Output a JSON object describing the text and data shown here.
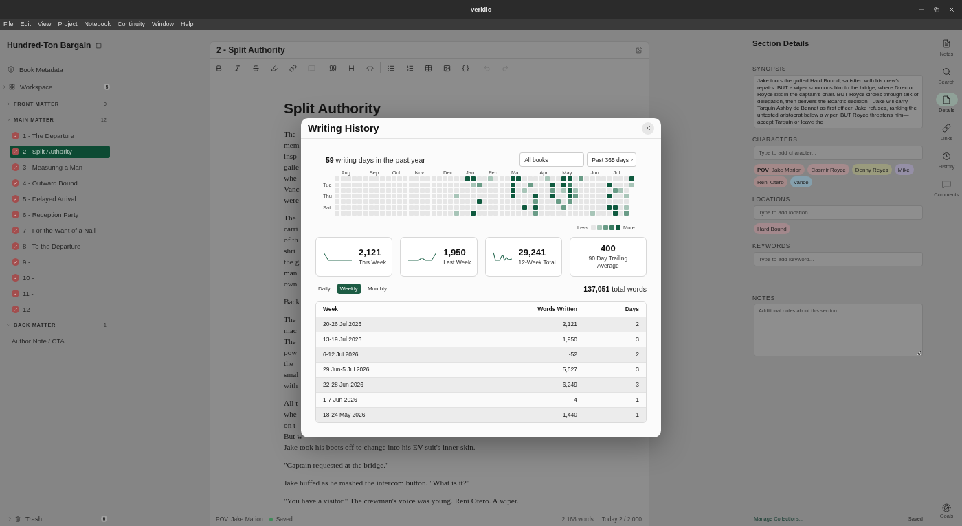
{
  "window": {
    "title": "Verkilo"
  },
  "menu": [
    "File",
    "Edit",
    "View",
    "Project",
    "Notebook",
    "Continuity",
    "Window",
    "Help"
  ],
  "sidebar": {
    "title": "Hundred-Ton Bargain",
    "metadata": {
      "label": "Book Metadata"
    },
    "workspace": {
      "label": "Workspace",
      "count": "5",
      "expanded": false
    },
    "sections": [
      {
        "label": "FRONT MATTER",
        "count": "0",
        "expanded": false
      },
      {
        "label": "MAIN MATTER",
        "count": "12",
        "expanded": true,
        "items": [
          {
            "kind": "chapter",
            "label": "1 - The Departure",
            "selected": false
          },
          {
            "kind": "chapter",
            "label": "2 - Split Authority",
            "selected": true
          },
          {
            "kind": "chapter",
            "label": "3 - Measuring a Man",
            "selected": false
          },
          {
            "kind": "chapter",
            "label": "4 - Outward Bound",
            "selected": false
          },
          {
            "kind": "chapter",
            "label": "5 - Delayed Arrival",
            "selected": false
          },
          {
            "kind": "chapter",
            "label": "6 - Reception Party",
            "selected": false
          },
          {
            "kind": "chapter",
            "label": "7 - For the Want of a Nail",
            "selected": false
          },
          {
            "kind": "chapter",
            "label": "8 - To the Departure",
            "selected": false
          },
          {
            "kind": "chapter",
            "label": "9 -",
            "selected": false
          },
          {
            "kind": "chapter",
            "label": "10 -",
            "selected": false
          },
          {
            "kind": "chapter",
            "label": "11 -",
            "selected": false
          },
          {
            "kind": "chapter",
            "label": "12 -",
            "selected": false
          }
        ]
      },
      {
        "label": "BACK MATTER",
        "count": "1",
        "expanded": true,
        "items": [
          {
            "kind": "page",
            "label": "Author Note / CTA",
            "selected": false
          }
        ]
      }
    ],
    "trash": {
      "label": "Trash",
      "count": "0",
      "expanded": false
    }
  },
  "editor": {
    "title": "2 - Split Authority",
    "toolbar": [
      [
        {
          "kind": "bold",
          "disabled": false
        },
        {
          "kind": "italic",
          "disabled": false
        },
        {
          "kind": "strikethrough",
          "disabled": false
        },
        {
          "kind": "highlight",
          "disabled": false
        },
        {
          "kind": "link",
          "disabled": false
        },
        {
          "kind": "comment",
          "disabled": true
        }
      ],
      [
        {
          "kind": "quote",
          "disabled": false
        },
        {
          "kind": "heading",
          "disabled": false
        },
        {
          "kind": "code",
          "disabled": false
        }
      ],
      [
        {
          "kind": "bullet_list",
          "disabled": false
        },
        {
          "kind": "numbered_list",
          "disabled": false
        },
        {
          "kind": "table",
          "disabled": false
        },
        {
          "kind": "image",
          "disabled": false
        },
        {
          "kind": "variable",
          "disabled": false
        }
      ],
      [
        {
          "kind": "undo",
          "disabled": true
        },
        {
          "kind": "redo",
          "disabled": true
        }
      ]
    ],
    "heading": "Split Authority",
    "paragraphs": [
      {
        "lines": [
          "The",
          "mem",
          "insp",
          "galle",
          "whe",
          "Vanc",
          "were"
        ]
      },
      {
        "lines": [
          "The",
          "carri",
          "of th",
          "shri",
          "the g",
          "man",
          "own"
        ]
      },
      {
        "lines": [
          "Back"
        ]
      },
      {
        "lines": [
          "The",
          "mac",
          "The",
          "pow",
          "the",
          "smal",
          "with"
        ]
      },
      {
        "lines": [
          "All t",
          "whe",
          "on t",
          "But w",
          "Jake took his boots off to change into his EV suit's inner skin."
        ]
      },
      {
        "lines": [
          "\"Captain requested at the bridge.\""
        ]
      },
      {
        "lines": [
          "Jake huffed as he mashed the intercom button. \"What is it?\""
        ]
      },
      {
        "lines": [
          "\"You have a visitor.\" The crewman's voice was young. Reni Otero. A wiper."
        ]
      }
    ],
    "status_bar": {
      "pov": "POV: Jake Marion",
      "save_state": "Saved",
      "word_count": "2,168 words",
      "daily_goal": "Today 2 / 2,000"
    }
  },
  "details": {
    "title": "Section Details",
    "synopsis": {
      "label": "SYNOPSIS",
      "value": "Jake tours the gutted Hard Bound, satisfied with his crew's repairs. BUT a wiper summons him to the bridge, where Director Royce sits in the captain's chair. BUT Royce circles through talk of delegation, then delivers the Board's decision—Jake will carry Tarquin Ashby de Bennet as first officer. Jake refuses, ranking the untested aristocrat below a wiper. BUT Royce threatens him—accept Tarquin or leave the"
    },
    "characters": {
      "label": "CHARACTERS",
      "placeholder": "Type to add character...",
      "tags": [
        {
          "label": "**POV** Jake Marion",
          "color": "#a38888"
        },
        {
          "label": "Casmir Royce",
          "color": "#a58a8c"
        },
        {
          "label": "Denny Reyes",
          "color": "#9a9b7d"
        },
        {
          "label": "Mikel",
          "color": "#958fa6"
        },
        {
          "label": "Reni Otero",
          "color": "#a38888"
        },
        {
          "label": "Vance",
          "color": "#85a0ad"
        }
      ]
    },
    "locations": {
      "label": "LOCATIONS",
      "placeholder": "Type to add location...",
      "tags": [
        {
          "label": "Hard Bound",
          "color": "#a3888c"
        }
      ]
    },
    "keywords": {
      "label": "KEYWORDS",
      "placeholder": "Type to add keyword..."
    },
    "notes": {
      "label": "NOTES",
      "placeholder": "Additional notes about this section..."
    },
    "footer_link": "Manage Collections...",
    "save_state": "Saved"
  },
  "rail": {
    "items": [
      {
        "kind": "notes",
        "label": "Notes",
        "selected": false
      },
      {
        "kind": "search",
        "label": "Search",
        "selected": false
      },
      {
        "kind": "details",
        "label": "Details",
        "selected": true
      },
      {
        "kind": "links",
        "label": "Links",
        "selected": false
      },
      {
        "kind": "history",
        "label": "History",
        "selected": false
      },
      {
        "kind": "comments",
        "label": "Comments",
        "selected": false
      }
    ],
    "goals": {
      "label": "Goals"
    }
  },
  "writing_history": {
    "title": "Writing History",
    "summary": "**59** writing days in the past year",
    "filters": [
      {
        "kind": "input",
        "value": "All books"
      },
      {
        "kind": "dropdown",
        "value": "Past 365 days"
      }
    ],
    "heatmap": {
      "day_labels": [
        "Tue",
        "Thu",
        "Sat"
      ],
      "weeks": [
        {
          "days": [
            {
              "color": "#e6e6e6"
            },
            {
              "color": "#e6e6e6"
            },
            {
              "color": "#e6e6e6"
            },
            {
              "color": "#e6e6e6"
            },
            {
              "color": "#e6e6e6"
            },
            {
              "color": "#e6e6e6"
            },
            {
              "color": "#e6e6e6"
            }
          ]
        },
        {
          "month": "Aug",
          "days": [
            {
              "color": "#e6e6e6"
            },
            {
              "color": "#e6e6e6"
            },
            {
              "color": "#e6e6e6"
            },
            {
              "color": "#e6e6e6"
            },
            {
              "color": "#e6e6e6"
            },
            {
              "color": "#e6e6e6"
            },
            {
              "color": "#e6e6e6"
            }
          ]
        },
        {
          "days": [
            {
              "color": "#e6e6e6"
            },
            {
              "color": "#e6e6e6"
            },
            {
              "color": "#e6e6e6"
            },
            {
              "color": "#e6e6e6"
            },
            {
              "color": "#e6e6e6"
            },
            {
              "color": "#e6e6e6"
            },
            {
              "color": "#e6e6e6"
            }
          ]
        },
        {
          "days": [
            {
              "color": "#e6e6e6"
            },
            {
              "color": "#e6e6e6"
            },
            {
              "color": "#e6e6e6"
            },
            {
              "color": "#e6e6e6"
            },
            {
              "color": "#e6e6e6"
            },
            {
              "color": "#e6e6e6"
            },
            {
              "color": "#e6e6e6"
            }
          ]
        },
        {
          "days": [
            {
              "color": "#e6e6e6"
            },
            {
              "color": "#e6e6e6"
            },
            {
              "color": "#e6e6e6"
            },
            {
              "color": "#e6e6e6"
            },
            {
              "color": "#e6e6e6"
            },
            {
              "color": "#e6e6e6"
            },
            {
              "color": "#e6e6e6"
            }
          ]
        },
        {
          "days": [
            {
              "color": "#e6e6e6"
            },
            {
              "color": "#e6e6e6"
            },
            {
              "color": "#e6e6e6"
            },
            {
              "color": "#e6e6e6"
            },
            {
              "color": "#e6e6e6"
            },
            {
              "color": "#e6e6e6"
            },
            {
              "color": "#e6e6e6"
            }
          ]
        },
        {
          "month": "Sep",
          "days": [
            {
              "color": "#e6e6e6"
            },
            {
              "color": "#e6e6e6"
            },
            {
              "color": "#e6e6e6"
            },
            {
              "color": "#e6e6e6"
            },
            {
              "color": "#e6e6e6"
            },
            {
              "color": "#e6e6e6"
            },
            {
              "color": "#e6e6e6"
            }
          ]
        },
        {
          "days": [
            {
              "color": "#e6e6e6"
            },
            {
              "color": "#e6e6e6"
            },
            {
              "color": "#e6e6e6"
            },
            {
              "color": "#e6e6e6"
            },
            {
              "color": "#e6e6e6"
            },
            {
              "color": "#e6e6e6"
            },
            {
              "color": "#e6e6e6"
            }
          ]
        },
        {
          "days": [
            {
              "color": "#e6e6e6"
            },
            {
              "color": "#e6e6e6"
            },
            {
              "color": "#e6e6e6"
            },
            {
              "color": "#e6e6e6"
            },
            {
              "color": "#e6e6e6"
            },
            {
              "color": "#e6e6e6"
            },
            {
              "color": "#e6e6e6"
            }
          ]
        },
        {
          "days": [
            {
              "color": "#e6e6e6"
            },
            {
              "color": "#e6e6e6"
            },
            {
              "color": "#e6e6e6"
            },
            {
              "color": "#e6e6e6"
            },
            {
              "color": "#e6e6e6"
            },
            {
              "color": "#e6e6e6"
            },
            {
              "color": "#e6e6e6"
            }
          ]
        },
        {
          "month": "Oct",
          "days": [
            {
              "color": "#e6e6e6"
            },
            {
              "color": "#e6e6e6"
            },
            {
              "color": "#e6e6e6"
            },
            {
              "color": "#e6e6e6"
            },
            {
              "color": "#e6e6e6"
            },
            {
              "color": "#e6e6e6"
            },
            {
              "color": "#e6e6e6"
            }
          ]
        },
        {
          "days": [
            {
              "color": "#e6e6e6"
            },
            {
              "color": "#e6e6e6"
            },
            {
              "color": "#e6e6e6"
            },
            {
              "color": "#e6e6e6"
            },
            {
              "color": "#e6e6e6"
            },
            {
              "color": "#e6e6e6"
            },
            {
              "color": "#e6e6e6"
            }
          ]
        },
        {
          "days": [
            {
              "color": "#e6e6e6"
            },
            {
              "color": "#e6e6e6"
            },
            {
              "color": "#e6e6e6"
            },
            {
              "color": "#e6e6e6"
            },
            {
              "color": "#e6e6e6"
            },
            {
              "color": "#e6e6e6"
            },
            {
              "color": "#e6e6e6"
            }
          ]
        },
        {
          "days": [
            {
              "color": "#e6e6e6"
            },
            {
              "color": "#e6e6e6"
            },
            {
              "color": "#e6e6e6"
            },
            {
              "color": "#e6e6e6"
            },
            {
              "color": "#e6e6e6"
            },
            {
              "color": "#e6e6e6"
            },
            {
              "color": "#e6e6e6"
            }
          ]
        },
        {
          "month": "Nov",
          "days": [
            {
              "color": "#e6e6e6"
            },
            {
              "color": "#e6e6e6"
            },
            {
              "color": "#e6e6e6"
            },
            {
              "color": "#e6e6e6"
            },
            {
              "color": "#e6e6e6"
            },
            {
              "color": "#e6e6e6"
            },
            {
              "color": "#e6e6e6"
            }
          ]
        },
        {
          "days": [
            {
              "color": "#e6e6e6"
            },
            {
              "color": "#e6e6e6"
            },
            {
              "color": "#e6e6e6"
            },
            {
              "color": "#e6e6e6"
            },
            {
              "color": "#e6e6e6"
            },
            {
              "color": "#e6e6e6"
            },
            {
              "color": "#e6e6e6"
            }
          ]
        },
        {
          "days": [
            {
              "color": "#e6e6e6"
            },
            {
              "color": "#e6e6e6"
            },
            {
              "color": "#e6e6e6"
            },
            {
              "color": "#e6e6e6"
            },
            {
              "color": "#e6e6e6"
            },
            {
              "color": "#e6e6e6"
            },
            {
              "color": "#e6e6e6"
            }
          ]
        },
        {
          "days": [
            {
              "color": "#e6e6e6"
            },
            {
              "color": "#e6e6e6"
            },
            {
              "color": "#e6e6e6"
            },
            {
              "color": "#e6e6e6"
            },
            {
              "color": "#e6e6e6"
            },
            {
              "color": "#e6e6e6"
            },
            {
              "color": "#e6e6e6"
            }
          ]
        },
        {
          "days": [
            {
              "color": "#e6e6e6"
            },
            {
              "color": "#e6e6e6"
            },
            {
              "color": "#e6e6e6"
            },
            {
              "color": "#e6e6e6"
            },
            {
              "color": "#e6e6e6"
            },
            {
              "color": "#e6e6e6"
            },
            {
              "color": "#e6e6e6"
            }
          ]
        },
        {
          "month": "Dec",
          "days": [
            {
              "color": "#e6e6e6"
            },
            {
              "color": "#e6e6e6"
            },
            {
              "color": "#e6e6e6"
            },
            {
              "color": "#e6e6e6"
            },
            {
              "color": "#e6e6e6"
            },
            {
              "color": "#e6e6e6"
            },
            {
              "color": "#e6e6e6"
            }
          ]
        },
        {
          "days": [
            {
              "color": "#e6e6e6"
            },
            {
              "color": "#e6e6e6"
            },
            {
              "color": "#e6e6e6"
            },
            {
              "color": "#e6e6e6"
            },
            {
              "color": "#e6e6e6"
            },
            {
              "color": "#e6e6e6"
            },
            {
              "color": "#e6e6e6"
            }
          ]
        },
        {
          "days": [
            {
              "color": "#e6e6e6"
            },
            {
              "color": "#e6e6e6"
            },
            {
              "color": "#e6e6e6"
            },
            {
              "color": "#a8c5b8"
            },
            {
              "color": "#e6e6e6"
            },
            {
              "color": "#e6e6e6"
            },
            {
              "color": "#a8c5b8"
            }
          ]
        },
        {
          "days": [
            {
              "color": "#e6e6e6"
            },
            {
              "color": "#e6e6e6"
            },
            {
              "color": "#e6e6e6"
            },
            {
              "color": "#e6e6e6"
            },
            {
              "color": "#e6e6e6"
            },
            {
              "color": "#e6e6e6"
            },
            {
              "color": "#e6e6e6"
            }
          ]
        },
        {
          "month": "Jan",
          "days": [
            {
              "color": "#0f5a3f"
            },
            {
              "color": "#e6e6e6"
            },
            {
              "color": "#e6e6e6"
            },
            {
              "color": "#e6e6e6"
            },
            {
              "color": "#e6e6e6"
            },
            {
              "color": "#e6e6e6"
            },
            {
              "color": "#e6e6e6"
            }
          ]
        },
        {
          "days": [
            {
              "color": "#0f5a3f"
            },
            {
              "color": "#a8c5b8"
            },
            {
              "color": "#e6e6e6"
            },
            {
              "color": "#e6e6e6"
            },
            {
              "color": "#e6e6e6"
            },
            {
              "color": "#e6e6e6"
            },
            {
              "color": "#0f5a3f"
            }
          ]
        },
        {
          "days": [
            {
              "color": "#e6e6e6"
            },
            {
              "color": "#6a9c87"
            },
            {
              "color": "#e6e6e6"
            },
            {
              "color": "#e6e6e6"
            },
            {
              "color": "#0f5a3f"
            },
            {
              "color": "#e6e6e6"
            },
            {
              "color": "#e6e6e6"
            }
          ]
        },
        {
          "days": [
            {
              "color": "#e6e6e6"
            },
            {
              "color": "#e6e6e6"
            },
            {
              "color": "#e6e6e6"
            },
            {
              "color": "#e6e6e6"
            },
            {
              "color": "#e6e6e6"
            },
            {
              "color": "#e6e6e6"
            },
            {
              "color": "#e6e6e6"
            }
          ]
        },
        {
          "month": "Feb",
          "days": [
            {
              "color": "#a8c5b8"
            },
            {
              "color": "#e6e6e6"
            },
            {
              "color": "#e6e6e6"
            },
            {
              "color": "#e6e6e6"
            },
            {
              "color": "#e6e6e6"
            },
            {
              "color": "#e6e6e6"
            },
            {
              "color": "#e6e6e6"
            }
          ]
        },
        {
          "days": [
            {
              "color": "#e6e6e6"
            },
            {
              "color": "#e6e6e6"
            },
            {
              "color": "#e6e6e6"
            },
            {
              "color": "#e6e6e6"
            },
            {
              "color": "#e6e6e6"
            },
            {
              "color": "#e6e6e6"
            },
            {
              "color": "#e6e6e6"
            }
          ]
        },
        {
          "days": [
            {
              "color": "#e6e6e6"
            },
            {
              "color": "#e6e6e6"
            },
            {
              "color": "#e6e6e6"
            },
            {
              "color": "#e6e6e6"
            },
            {
              "color": "#e6e6e6"
            },
            {
              "color": "#e6e6e6"
            },
            {
              "color": "#e6e6e6"
            }
          ]
        },
        {
          "days": [
            {
              "color": "#e6e6e6"
            },
            {
              "color": "#e6e6e6"
            },
            {
              "color": "#e6e6e6"
            },
            {
              "color": "#e6e6e6"
            },
            {
              "color": "#e6e6e6"
            },
            {
              "color": "#e6e6e6"
            },
            {
              "color": "#e6e6e6"
            }
          ]
        },
        {
          "month": "Mar",
          "days": [
            {
              "color": "#0f5a3f"
            },
            {
              "color": "#0f5a3f"
            },
            {
              "color": "#0f5a3f"
            },
            {
              "color": "#0f5a3f"
            },
            {
              "color": "#e6e6e6"
            },
            {
              "color": "#e6e6e6"
            },
            {
              "color": "#e6e6e6"
            }
          ]
        },
        {
          "days": [
            {
              "color": "#0f5a3f"
            },
            {
              "color": "#e6e6e6"
            },
            {
              "color": "#e6e6e6"
            },
            {
              "color": "#e6e6e6"
            },
            {
              "color": "#e6e6e6"
            },
            {
              "color": "#e6e6e6"
            },
            {
              "color": "#e6e6e6"
            }
          ]
        },
        {
          "days": [
            {
              "color": "#e6e6e6"
            },
            {
              "color": "#e6e6e6"
            },
            {
              "color": "#a8c5b8"
            },
            {
              "color": "#e6e6e6"
            },
            {
              "color": "#e6e6e6"
            },
            {
              "color": "#0f5a3f"
            },
            {
              "color": "#e6e6e6"
            }
          ]
        },
        {
          "days": [
            {
              "color": "#e6e6e6"
            },
            {
              "color": "#6a9c87"
            },
            {
              "color": "#e6e6e6"
            },
            {
              "color": "#e6e6e6"
            },
            {
              "color": "#e6e6e6"
            },
            {
              "color": "#e6e6e6"
            },
            {
              "color": "#e6e6e6"
            }
          ]
        },
        {
          "days": [
            {
              "color": "#e6e6e6"
            },
            {
              "color": "#e6e6e6"
            },
            {
              "color": "#e6e6e6"
            },
            {
              "color": "#0f5a3f"
            },
            {
              "color": "#6a9c87"
            },
            {
              "color": "#0f5a3f"
            },
            {
              "color": "#6a9c87"
            }
          ]
        },
        {
          "month": "Apr",
          "days": [
            {
              "color": "#e6e6e6"
            },
            {
              "color": "#e6e6e6"
            },
            {
              "color": "#e6e6e6"
            },
            {
              "color": "#e6e6e6"
            },
            {
              "color": "#e6e6e6"
            },
            {
              "color": "#e6e6e6"
            },
            {
              "color": "#e6e6e6"
            }
          ]
        },
        {
          "days": [
            {
              "color": "#a8c5b8"
            },
            {
              "color": "#e6e6e6"
            },
            {
              "color": "#e6e6e6"
            },
            {
              "color": "#e6e6e6"
            },
            {
              "color": "#e6e6e6"
            },
            {
              "color": "#e6e6e6"
            },
            {
              "color": "#e6e6e6"
            }
          ]
        },
        {
          "days": [
            {
              "color": "#e6e6e6"
            },
            {
              "color": "#0f5a3f"
            },
            {
              "color": "#6a9c87"
            },
            {
              "color": "#0f5a3f"
            },
            {
              "color": "#e6e6e6"
            },
            {
              "color": "#e6e6e6"
            },
            {
              "color": "#e6e6e6"
            }
          ]
        },
        {
          "days": [
            {
              "color": "#e6e6e6"
            },
            {
              "color": "#e6e6e6"
            },
            {
              "color": "#e6e6e6"
            },
            {
              "color": "#e6e6e6"
            },
            {
              "color": "#6a9c87"
            },
            {
              "color": "#e6e6e6"
            },
            {
              "color": "#e6e6e6"
            }
          ]
        },
        {
          "month": "May",
          "days": [
            {
              "color": "#0f5a3f"
            },
            {
              "color": "#0f5a3f"
            },
            {
              "color": "#a8c5b8"
            },
            {
              "color": "#e6e6e6"
            },
            {
              "color": "#e6e6e6"
            },
            {
              "color": "#6a9c87"
            },
            {
              "color": "#e6e6e6"
            }
          ]
        },
        {
          "days": [
            {
              "color": "#0f5a3f"
            },
            {
              "color": "#3c7d63"
            },
            {
              "color": "#0f5a3f"
            },
            {
              "color": "#0f5a3f"
            },
            {
              "color": "#6a9c87"
            },
            {
              "color": "#e6e6e6"
            },
            {
              "color": "#e6e6e6"
            }
          ]
        },
        {
          "days": [
            {
              "color": "#e6e6e6"
            },
            {
              "color": "#e6e6e6"
            },
            {
              "color": "#a8c5b8"
            },
            {
              "color": "#6a9c87"
            },
            {
              "color": "#e6e6e6"
            },
            {
              "color": "#e6e6e6"
            },
            {
              "color": "#e6e6e6"
            }
          ]
        },
        {
          "days": [
            {
              "color": "#6a9c87"
            },
            {
              "color": "#e6e6e6"
            },
            {
              "color": "#e6e6e6"
            },
            {
              "color": "#e6e6e6"
            },
            {
              "color": "#e6e6e6"
            },
            {
              "color": "#e6e6e6"
            },
            {
              "color": "#e6e6e6"
            }
          ]
        },
        {
          "days": [
            {
              "color": "#e6e6e6"
            },
            {
              "color": "#e6e6e6"
            },
            {
              "color": "#e6e6e6"
            },
            {
              "color": "#e6e6e6"
            },
            {
              "color": "#e6e6e6"
            },
            {
              "color": "#e6e6e6"
            },
            {
              "color": "#e6e6e6"
            }
          ]
        },
        {
          "month": "Jun",
          "days": [
            {
              "color": "#e6e6e6"
            },
            {
              "color": "#e6e6e6"
            },
            {
              "color": "#e6e6e6"
            },
            {
              "color": "#e6e6e6"
            },
            {
              "color": "#e6e6e6"
            },
            {
              "color": "#e6e6e6"
            },
            {
              "color": "#a8c5b8"
            }
          ]
        },
        {
          "days": [
            {
              "color": "#e6e6e6"
            },
            {
              "color": "#e6e6e6"
            },
            {
              "color": "#e6e6e6"
            },
            {
              "color": "#e6e6e6"
            },
            {
              "color": "#e6e6e6"
            },
            {
              "color": "#e6e6e6"
            },
            {
              "color": "#e6e6e6"
            }
          ]
        },
        {
          "days": [
            {
              "color": "#e6e6e6"
            },
            {
              "color": "#e6e6e6"
            },
            {
              "color": "#e6e6e6"
            },
            {
              "color": "#e6e6e6"
            },
            {
              "color": "#e6e6e6"
            },
            {
              "color": "#e6e6e6"
            },
            {
              "color": "#e6e6e6"
            }
          ]
        },
        {
          "days": [
            {
              "color": "#e6e6e6"
            },
            {
              "color": "#0f5a3f"
            },
            {
              "color": "#e6e6e6"
            },
            {
              "color": "#0f5a3f"
            },
            {
              "color": "#e6e6e6"
            },
            {
              "color": "#0f5a3f"
            },
            {
              "color": "#e6e6e6"
            }
          ]
        },
        {
          "month": "Jul",
          "days": [
            {
              "color": "#e6e6e6"
            },
            {
              "color": "#e6e6e6"
            },
            {
              "color": "#6a9c87"
            },
            {
              "color": "#e6e6e6"
            },
            {
              "color": "#e6e6e6"
            },
            {
              "color": "#0f5a3f"
            },
            {
              "color": "#0f5a3f"
            }
          ]
        },
        {
          "days": [
            {
              "color": "#e6e6e6"
            },
            {
              "color": "#e6e6e6"
            },
            {
              "color": "#a8c5b8"
            },
            {
              "color": "#e6e6e6"
            },
            {
              "color": "#e6e6e6"
            },
            {
              "color": "#e6e6e6"
            },
            {
              "color": "#e6e6e6"
            }
          ]
        },
        {
          "days": [
            {
              "color": "#e6e6e6"
            },
            {
              "color": "#e6e6e6"
            },
            {
              "color": "#e6e6e6"
            },
            {
              "color": "#a8c5b8"
            },
            {
              "color": "#e6e6e6"
            },
            {
              "color": "#a8c5b8"
            },
            {
              "color": "#6a9c87"
            }
          ]
        },
        {
          "days": [
            {
              "color": "#0f5a3f"
            },
            {
              "color": "#a8c5b8"
            }
          ]
        }
      ],
      "legend": {
        "low": "Less",
        "high": "More",
        "swatches": [
          {
            "color": "#e6e6e6"
          },
          {
            "color": "#a8c5b8"
          },
          {
            "color": "#6a9c87"
          },
          {
            "color": "#3c7d63"
          },
          {
            "color": "#0f5a3f"
          }
        ]
      }
    },
    "stats": [
      {
        "kind": "sparkline",
        "value": "2,121",
        "label": "This Week"
      },
      {
        "kind": "sparkline",
        "value": "1,950",
        "label": "Last Week"
      },
      {
        "kind": "sparkline",
        "value": "29,241",
        "label": "12-Week Total"
      },
      {
        "kind": "plain",
        "value": "400",
        "label": "90 Day Trailing Average"
      }
    ],
    "periods": [
      {
        "label": "Daily",
        "selected": false
      },
      {
        "label": "Weekly",
        "selected": true
      },
      {
        "label": "Monthly",
        "selected": false
      }
    ],
    "total": "**137,051** total words",
    "table": {
      "columns": [
        "Week",
        "Words Written",
        "Days"
      ],
      "rows": [
        [
          "20-26 Jul 2026",
          "2,121",
          "2"
        ],
        [
          "13-19 Jul 2026",
          "1,950",
          "3"
        ],
        [
          "6-12 Jul 2026",
          "-52",
          "2"
        ],
        [
          "29 Jun-5 Jul 2026",
          "5,627",
          "3"
        ],
        [
          "22-28 Jun 2026",
          "6,249",
          "3"
        ],
        [
          "1-7 Jun 2026",
          "4",
          "1"
        ],
        [
          "18-24 May 2026",
          "1,440",
          "1"
        ]
      ]
    }
  }
}
